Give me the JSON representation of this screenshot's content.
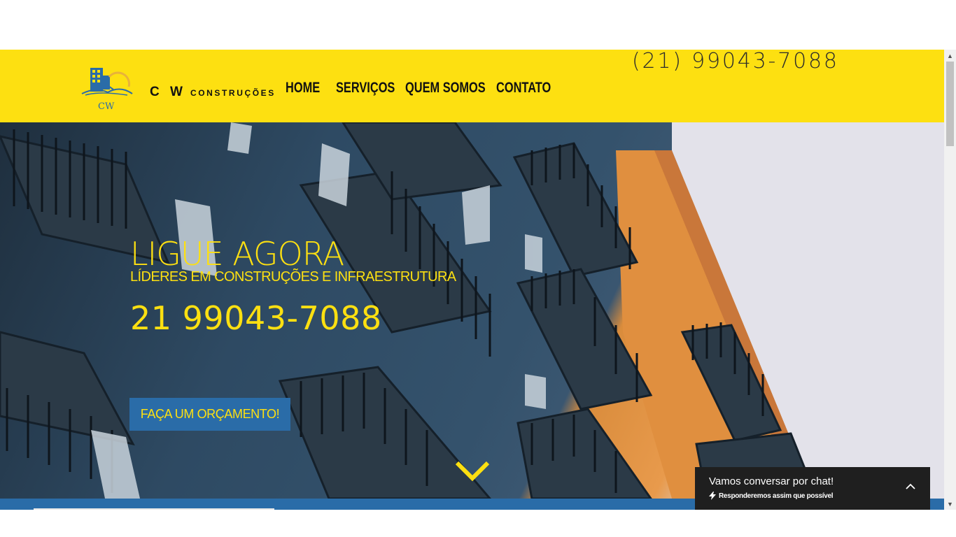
{
  "header": {
    "logo_text": "CW",
    "brand": "C W",
    "brand_sub": "CONSTRUÇÕES",
    "phone": "(21) 99043-7088",
    "nav": [
      "HOME",
      "SERVIÇOS",
      "QUEM SOMOS",
      "CONTATO"
    ]
  },
  "hero": {
    "title": "LIGUE AGORA",
    "subtitle": "LÍDERES EM CONSTRUÇÕES E INFRAESTRUTURA",
    "phone": "21 99043-7088",
    "cta": "FAÇA UM ORÇAMENTO!"
  },
  "chat": {
    "title": "Vamos conversar por chat!",
    "subtitle": "Responderemos assim que possível"
  },
  "colors": {
    "accent_yellow": "#fde011",
    "brand_blue": "#2a6ca8",
    "chat_bg": "#1f1f1f"
  },
  "icons": [
    "building-logo-icon",
    "chevron-down-icon",
    "lightning-icon",
    "chevron-up-icon"
  ]
}
